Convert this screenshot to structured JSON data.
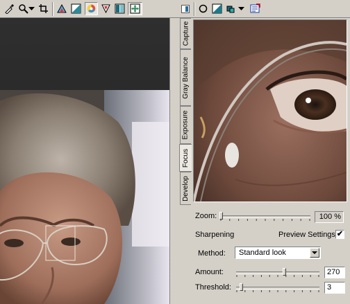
{
  "toolbar": {
    "tools": [
      "eyedropper-icon",
      "zoom-icon",
      "dropdown-arrow-icon",
      "crop-icon",
      "color-correction-icon",
      "levels-icon",
      "color-wheel-icon",
      "white-balance-icon",
      "compare-icon",
      "fit-view-icon"
    ],
    "right_tools": [
      "panel-toggle-icon",
      "circle-icon",
      "levels-icon",
      "layers-icon",
      "dropdown-arrow-icon",
      "export-icon"
    ]
  },
  "tabs": [
    "Capture",
    "Gray Balance",
    "Exposure",
    "Focus",
    "Develop"
  ],
  "active_tab": "Focus",
  "zoom": {
    "label": "Zoom:",
    "value": "100 %"
  },
  "sharpening": {
    "label": "Sharpening",
    "preview_label": "Preview Settings",
    "preview_checked": true,
    "preview_mark": "✔"
  },
  "method": {
    "label": "Method:",
    "value": "Standard look"
  },
  "amount": {
    "label": "Amount:",
    "value": "270",
    "fraction": 0.58
  },
  "threshold": {
    "label": "Threshold:",
    "value": "3",
    "fraction": 0.04
  },
  "colors": {
    "panel": "#d4d0c8",
    "accent": "#0a246a"
  }
}
